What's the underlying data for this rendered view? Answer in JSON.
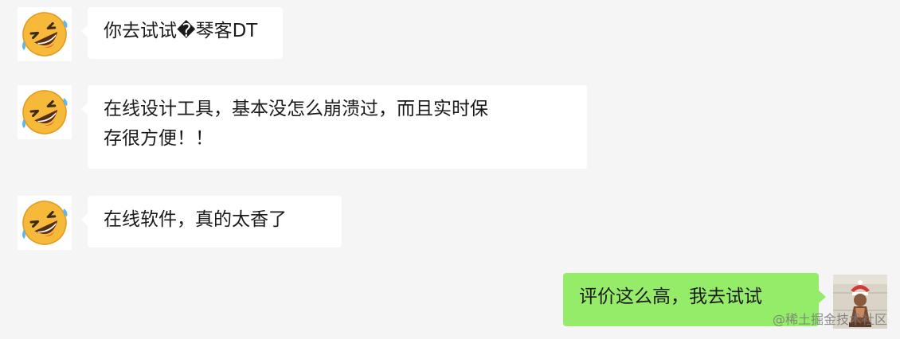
{
  "messages": [
    {
      "side": "left",
      "avatar_icon": "rolling-on-floor-laughing-icon",
      "text": "你去试试�琴客DT"
    },
    {
      "side": "left",
      "avatar_icon": "rolling-on-floor-laughing-icon",
      "text_line1": "在线设计工具，基本没怎么崩溃过，而且实时保",
      "text_line2": "存很方便！！"
    },
    {
      "side": "left",
      "avatar_icon": "rolling-on-floor-laughing-icon",
      "text": "在线软件，真的太香了"
    },
    {
      "side": "right",
      "avatar_icon": "user-avatar-icon",
      "text": "评价这么高，我去试试"
    }
  ],
  "watermark": "@稀土掘金技术社区",
  "colors": {
    "background": "#f5f5f5",
    "incoming_bubble": "#ffffff",
    "outgoing_bubble": "#95ec69",
    "emoji_yellow": "#f7b93a"
  }
}
